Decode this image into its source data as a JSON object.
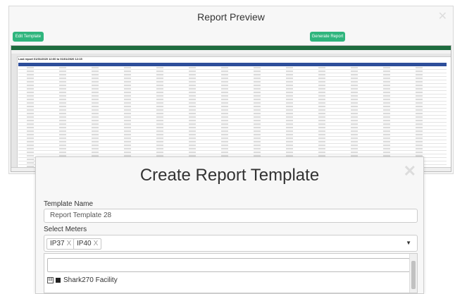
{
  "report_preview": {
    "title": "Report Preview",
    "edit_template_label": "Edit Template",
    "generate_report_label": "Generate Report",
    "sheet_heading": "Last report 01/01/2020 12:00 to 01/01/2020 12:15",
    "close_icon": "close-icon"
  },
  "modal": {
    "title": "Create Report Template",
    "close_icon": "close-icon",
    "template_name_label": "Template Name",
    "template_name_value": "Report Template 28",
    "select_meters_label": "Select Meters",
    "selected_meters": [
      "IP37",
      "IP40"
    ],
    "remove_symbol": "X",
    "caret_icon": "caret-down-icon",
    "tree": {
      "toggle": "⊟",
      "item": "Shark270 Facility"
    }
  },
  "colors": {
    "accent_green": "#2fb57d",
    "table_header_blue": "#2d4e9a",
    "excel_green": "#1e6b3e"
  }
}
